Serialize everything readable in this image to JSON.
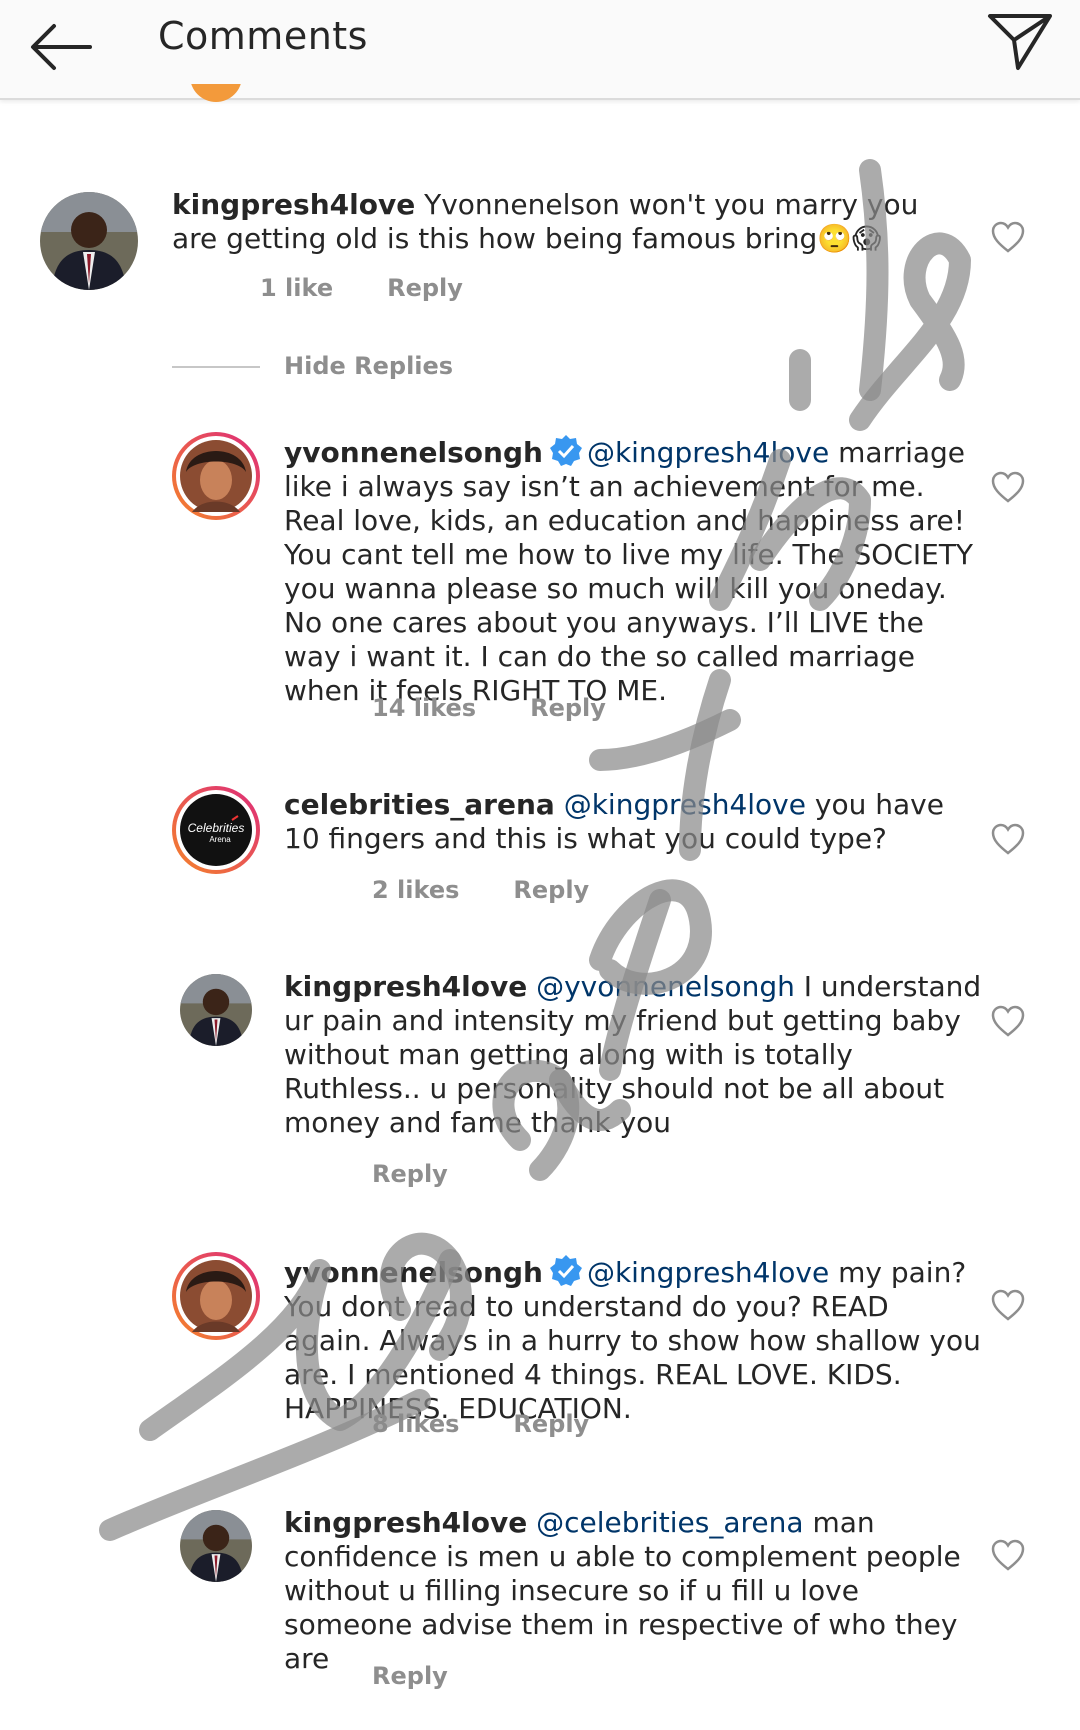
{
  "header": {
    "title": "Comments",
    "back_icon": "arrow-left-icon",
    "share_icon": "paper-plane-icon"
  },
  "hide_replies_label": "Hide Replies",
  "comments": [
    {
      "username": "kingpresh4love",
      "mention": "",
      "text": "Yvonnenelson won't you marry you are getting old is this how being famous bring🙄😱",
      "likes": "1 like",
      "reply_label": "Reply",
      "verified": false
    },
    {
      "username": "yvonnenelsongh",
      "mention": "@kingpresh4love",
      "text": "marriage like i always say isn’t an achievement for me. Real love, kids, an education and happiness are! You cant tell me how to live my life. The SOCIETY you wanna please so much will kill you oneday. No one cares about you anyways. I’ll LIVE the way i want it. I can do the so called marriage when it feels RIGHT TO ME.",
      "likes": "14 likes",
      "reply_label": "Reply",
      "verified": true
    },
    {
      "username": "celebrities_arena",
      "mention": "@kingpresh4love",
      "text": "you have 10 fingers and this is what you could type?",
      "likes": "2 likes",
      "reply_label": "Reply",
      "verified": false,
      "avatar_text": "Celebrities Arena"
    },
    {
      "username": "kingpresh4love",
      "mention": "@yvonnenelsongh",
      "text": "I understand ur pain and intensity my friend but getting baby without man getting along with is totally Ruthless.. u personality should not be all about money and fame thank you",
      "likes": "",
      "reply_label": "Reply",
      "verified": false
    },
    {
      "username": "yvonnenelsongh",
      "mention": "@kingpresh4love",
      "text": "my pain? You dont read to understand do you? READ again. Always in a hurry to show how shallow you are. I mentioned 4 things. REAL LOVE. KIDS. HAPPINESS. EDUCATION.",
      "likes": "8 likes",
      "reply_label": "Reply",
      "verified": true
    },
    {
      "username": "kingpresh4love",
      "mention": "@celebrities_arena",
      "text": "man confidence is men u able to complement people without u filling insecure so if u fill u love someone advise them in respective of who they are",
      "likes": "",
      "reply_label": "Reply",
      "verified": false
    }
  ],
  "watermark": "Yaaaaktoline",
  "colors": {
    "mention": "#003569",
    "meta": "#8e8e8e",
    "verified": "#3897f0",
    "story_ring_start": "#f58529",
    "story_ring_end": "#dd2a7b"
  }
}
